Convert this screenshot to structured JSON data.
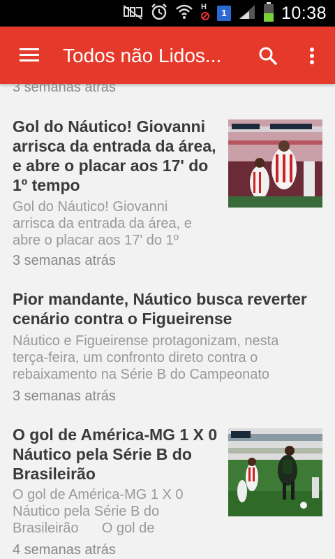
{
  "status_bar": {
    "time": "10:38",
    "notification_badge": "1",
    "icons": [
      "mute-icon",
      "alarm-icon",
      "wifi-icon",
      "hd-icon",
      "notification-icon",
      "signal-icon",
      "battery-icon"
    ]
  },
  "app_bar": {
    "title": "Todos não Lidos...",
    "background_color": "#e53a2b"
  },
  "feed": {
    "partial_time": "3 semanas atrás",
    "articles": [
      {
        "title_lines": [
          "Gol do Náutico! Giovanni",
          "arrisca da entrada da área,",
          "e abre o placar aos 17' do",
          "1º tempo"
        ],
        "excerpt_lines": [
          "Gol do Náutico! Giovanni",
          "arrisca da entrada da área, e",
          "abre o placar aos 17' do 1º"
        ],
        "time": "3 semanas atrás",
        "has_thumbnail": true
      },
      {
        "title_lines": [
          "Pior mandante, Náutico busca reverter",
          "cenário contra o Figueirense"
        ],
        "excerpt_lines": [
          "Náutico e Figueirense protagonizam, nesta",
          "terça-feira, um confronto direto contra o",
          "rebaixamento na Série B do Campeonato"
        ],
        "time": "3 semanas atrás",
        "has_thumbnail": false
      },
      {
        "title_lines": [
          "O gol de América-MG 1 X 0",
          "Náutico pela Série B do",
          "Brasileirão"
        ],
        "excerpt_lines": [
          "O gol de América-MG 1 X 0",
          "Náutico pela Série B do",
          "Brasileirão      O gol de"
        ],
        "time": "4 semanas atrás",
        "has_thumbnail": true
      }
    ]
  }
}
